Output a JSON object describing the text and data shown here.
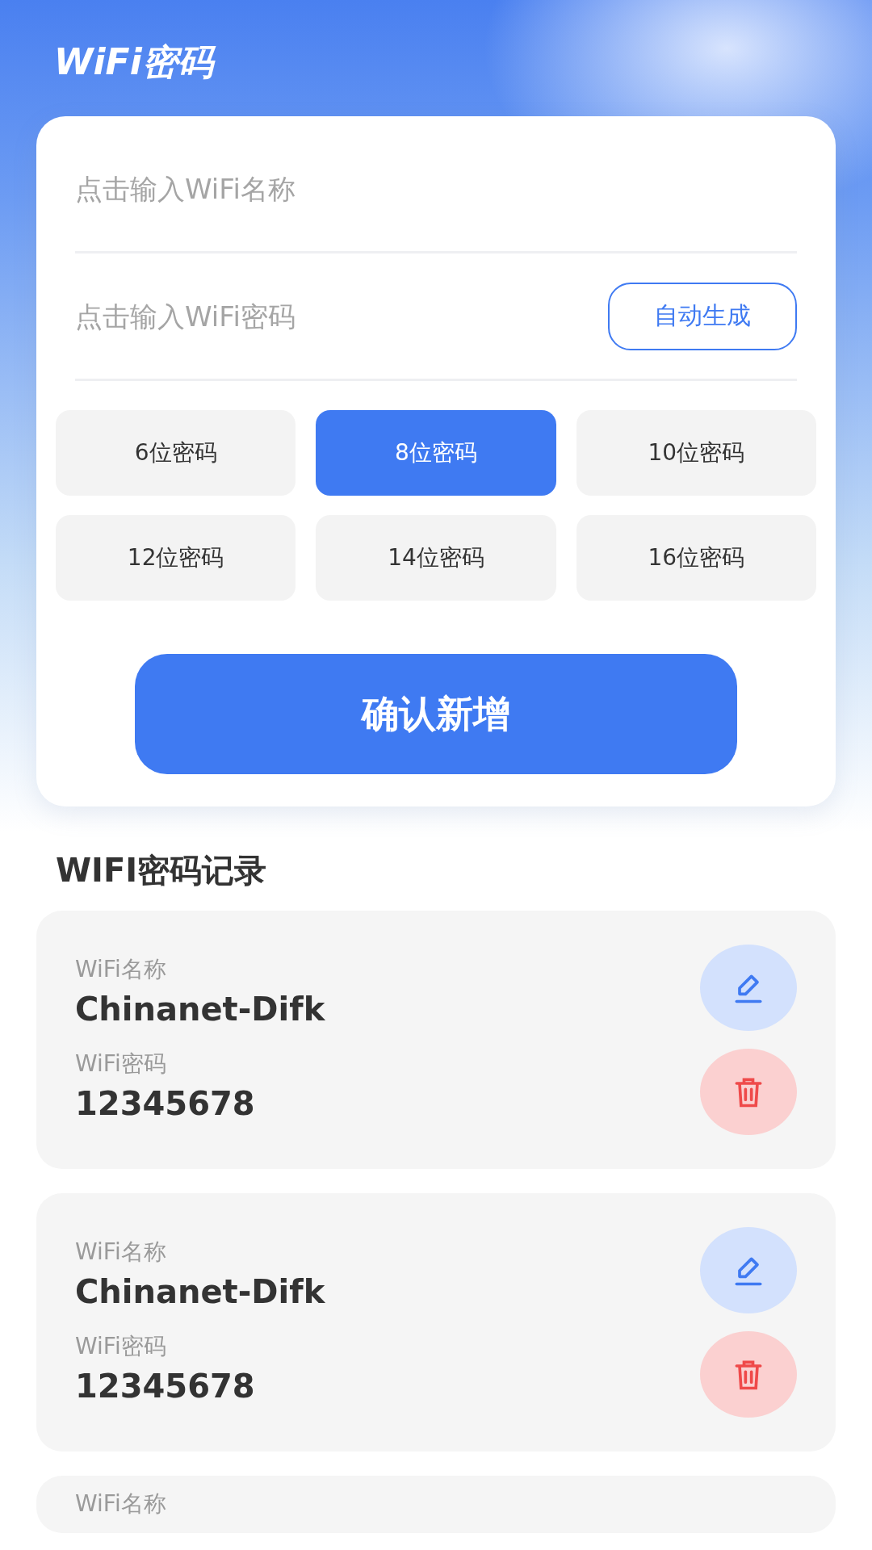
{
  "header": {
    "title": "WiFi密码"
  },
  "form": {
    "name_field": {
      "placeholder": "点击输入WiFi名称"
    },
    "password_field": {
      "placeholder": "点击输入WiFi密码"
    },
    "auto_button": "自动生成",
    "lengths": [
      {
        "label": "6位密码",
        "selected": false
      },
      {
        "label": "8位密码",
        "selected": true
      },
      {
        "label": "10位密码",
        "selected": false
      },
      {
        "label": "12位密码",
        "selected": false
      },
      {
        "label": "14位密码",
        "selected": false
      },
      {
        "label": "16位密码",
        "selected": false
      }
    ],
    "confirm_button": "确认新增"
  },
  "records": {
    "title": "WIFI密码记录",
    "items": [
      {
        "name_label": "WiFi名称",
        "name": "Chinanet-Difk",
        "password_label": "WiFi密码",
        "password": "12345678"
      },
      {
        "name_label": "WiFi名称",
        "name": "Chinanet-Difk",
        "password_label": "WiFi密码",
        "password": "12345678"
      },
      {
        "name_label": "WiFi名称"
      }
    ]
  }
}
